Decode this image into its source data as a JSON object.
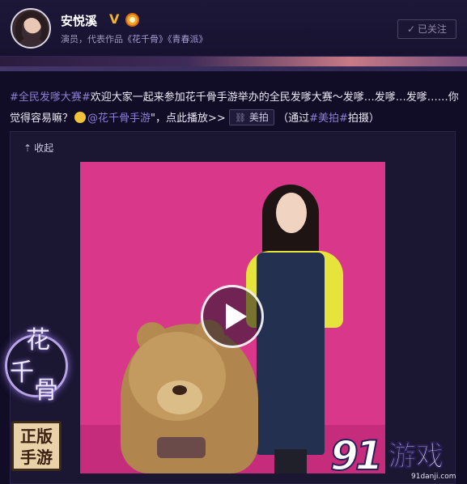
{
  "header": {
    "username": "安悦溪",
    "verified_badge": "V",
    "bio_prefix": "演员，代表作品",
    "bio_works": "《花千骨》《青春派》",
    "follow_button": "已关注",
    "follow_icon": "checkmark-icon"
  },
  "post": {
    "hashtag": "#全民发嗲大赛#",
    "text_1": "欢迎大家一起来参加花千骨手游举办的全民发嗲大赛～发嗲…发嗲…发嗲……你觉得容易嘛？",
    "mention": "@花千骨手游",
    "text_2": "\"，点此播放>>",
    "link_chip": "美拍",
    "via_prefix": "（通过",
    "via_tag": "#美拍#",
    "via_suffix": "拍摄）"
  },
  "media": {
    "collapse_label": "收起",
    "collapse_icon": "collapse-arrow-icon",
    "play_icon": "play-icon"
  },
  "overlays": {
    "stamp_text_top": "正版",
    "stamp_text_bottom": "手游",
    "watermark_number": "91",
    "watermark_name": "游戏",
    "watermark_domain": "91danji.com"
  },
  "colors": {
    "background": "#120d26",
    "accent_link": "#8c7fd6",
    "video_wall": "#d8378a"
  }
}
